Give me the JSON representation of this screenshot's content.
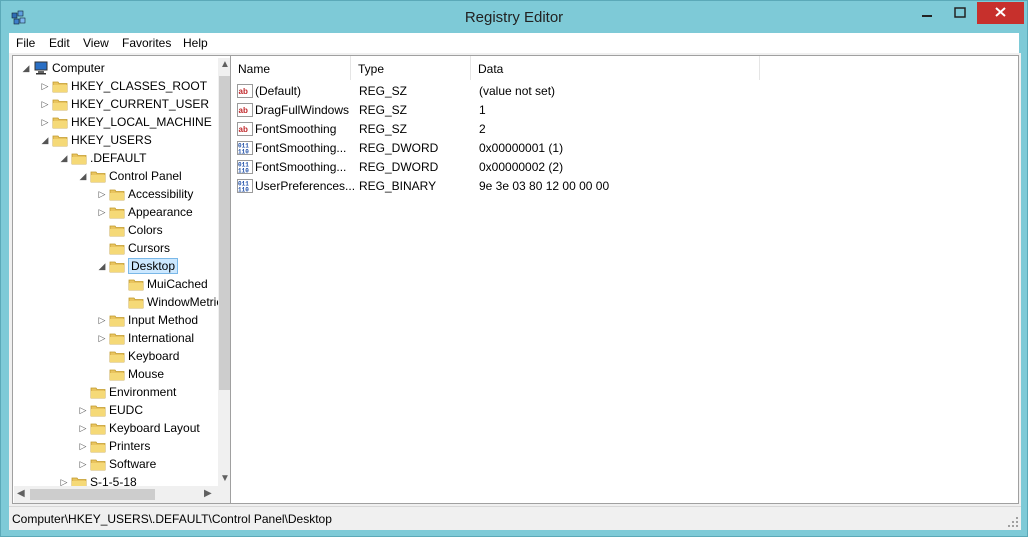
{
  "window": {
    "title": "Registry Editor"
  },
  "menu": [
    "File",
    "Edit",
    "View",
    "Favorites",
    "Help"
  ],
  "tree": [
    {
      "label": "Computer",
      "expander": "◢"
    },
    {
      "label": "HKEY_CLASSES_ROOT",
      "expander": "▷"
    },
    {
      "label": "HKEY_CURRENT_USER",
      "expander": "▷"
    },
    {
      "label": "HKEY_LOCAL_MACHINE",
      "expander": "▷"
    },
    {
      "label": "HKEY_USERS",
      "expander": "◢"
    },
    {
      "label": ".DEFAULT",
      "expander": "◢"
    },
    {
      "label": "Control Panel",
      "expander": "◢"
    },
    {
      "label": "Accessibility",
      "expander": "▷"
    },
    {
      "label": "Appearance",
      "expander": "▷"
    },
    {
      "label": "Colors",
      "expander": ""
    },
    {
      "label": "Cursors",
      "expander": ""
    },
    {
      "label": "Desktop",
      "expander": "◢",
      "selected": true
    },
    {
      "label": "MuiCached",
      "expander": ""
    },
    {
      "label": "WindowMetrics",
      "expander": ""
    },
    {
      "label": "Input Method",
      "expander": "▷"
    },
    {
      "label": "International",
      "expander": "▷"
    },
    {
      "label": "Keyboard",
      "expander": ""
    },
    {
      "label": "Mouse",
      "expander": ""
    },
    {
      "label": "Environment",
      "expander": ""
    },
    {
      "label": "EUDC",
      "expander": "▷"
    },
    {
      "label": "Keyboard Layout",
      "expander": "▷"
    },
    {
      "label": "Printers",
      "expander": "▷"
    },
    {
      "label": "Software",
      "expander": "▷"
    },
    {
      "label": "S-1-5-18",
      "expander": "▷"
    }
  ],
  "columns": {
    "name": "Name",
    "type": "Type",
    "data": "Data"
  },
  "values": [
    {
      "icon": "string-value-icon",
      "name": "(Default)",
      "type": "REG_SZ",
      "data": "(value not set)"
    },
    {
      "icon": "string-value-icon",
      "name": "DragFullWindows",
      "type": "REG_SZ",
      "data": "1"
    },
    {
      "icon": "string-value-icon",
      "name": "FontSmoothing",
      "type": "REG_SZ",
      "data": "2"
    },
    {
      "icon": "binary-value-icon",
      "name": "FontSmoothing...",
      "type": "REG_DWORD",
      "data": "0x00000001 (1)"
    },
    {
      "icon": "binary-value-icon",
      "name": "FontSmoothing...",
      "type": "REG_DWORD",
      "data": "0x00000002 (2)"
    },
    {
      "icon": "binary-value-icon",
      "name": "UserPreferences...",
      "type": "REG_BINARY",
      "data": "9e 3e 03 80 12 00 00 00"
    }
  ],
  "status": {
    "path": "Computer\\HKEY_USERS\\.DEFAULT\\Control Panel\\Desktop"
  }
}
